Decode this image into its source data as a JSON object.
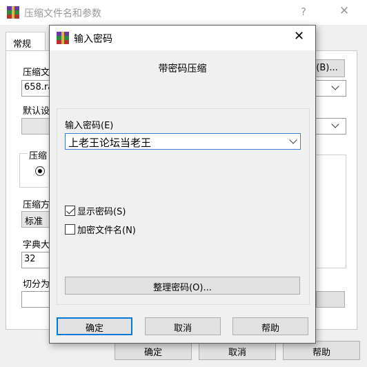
{
  "background_window": {
    "title": "压缩文件名和参数",
    "help_glyph": "?",
    "close_glyph": "✕",
    "tab_general": "常规",
    "archive_name_label": "压缩文",
    "archive_name_value": "658.ra",
    "browse_button": "(B)...",
    "default_profile_label": "默认设",
    "archive_format_label": "压缩",
    "compression_method_label": "压缩方",
    "compression_method_value": "标准",
    "dictionary_size_label": "字典大",
    "dictionary_size_value": "32",
    "split_volumes_label": "切分为",
    "ok_button": "确定",
    "cancel_button": "取消",
    "help_button": "帮助"
  },
  "dialog": {
    "title": "输入密码",
    "close_glyph": "✕",
    "heading": "带密码压缩",
    "password_label": "输入密码(E)",
    "password_value": "上老王论坛当老王",
    "show_password_label": "显示密码(S)",
    "show_password_checked": true,
    "encrypt_names_label": "加密文件名(N)",
    "encrypt_names_checked": false,
    "organize_button": "整理密码(O)...",
    "ok_button": "确定",
    "cancel_button": "取消",
    "help_button": "帮助"
  },
  "colors": {
    "accent": "#0078d7",
    "focus_border": "#3c7fd4"
  }
}
